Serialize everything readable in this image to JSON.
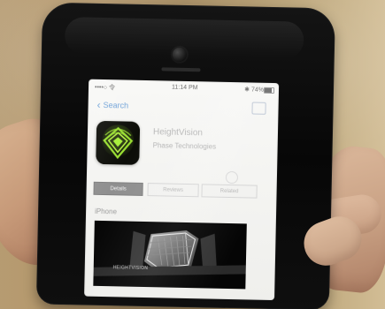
{
  "status_bar": {
    "left": "••••○ 令",
    "time": "11:14 PM",
    "right": "✱ 74%"
  },
  "nav": {
    "back_label": "Search"
  },
  "app": {
    "title": "HeightVision",
    "subtitle": "Phase Technologies"
  },
  "tabs": [
    {
      "label": "Details"
    },
    {
      "label": "Reviews"
    },
    {
      "label": "Related"
    }
  ],
  "section": {
    "device_label": "iPhone"
  },
  "preview": {
    "label": "HEIGHTVISION"
  },
  "colors": {
    "back_blue": "#6ea1d8",
    "icon_green": "#90d42b",
    "active_tab": "#8f8f8f"
  }
}
